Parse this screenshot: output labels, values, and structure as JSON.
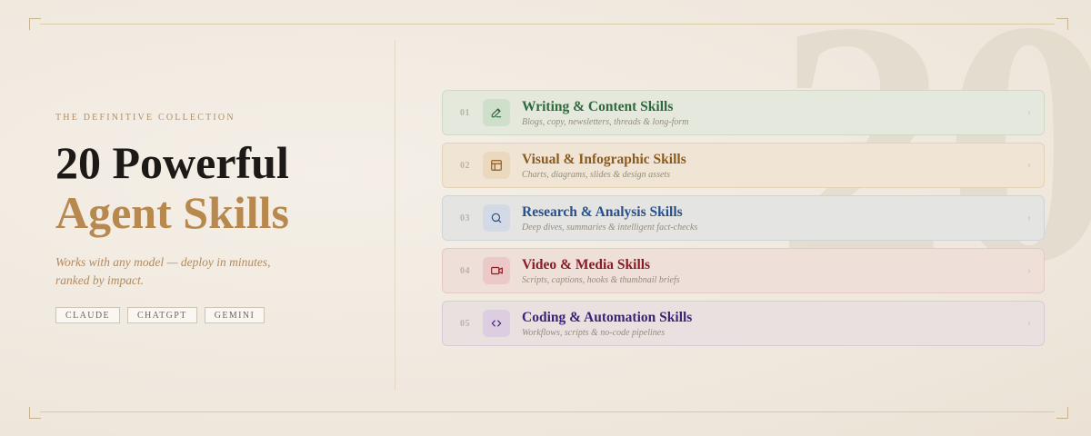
{
  "background_number": "20",
  "eyebrow": "THE DEFINITIVE COLLECTION",
  "title": {
    "line1": "20 Powerful",
    "line2": "Agent Skills"
  },
  "tagline": "Works with any model — deploy in minutes, ranked by impact.",
  "badges": [
    "CLAUDE",
    "CHATGPT",
    "GEMINI"
  ],
  "skills": [
    {
      "num": "01",
      "title": "Writing & Content Skills",
      "subtitle": "Blogs, copy, newsletters, threads & long-form",
      "icon": "pencil-icon",
      "chevron": "›",
      "colors": {
        "bg": "#e5e9dd",
        "border": "#cddbc4",
        "icon_bg": "#cfdfcb",
        "accent": "#2e6b3c"
      }
    },
    {
      "num": "02",
      "title": "Visual & Infographic Skills",
      "subtitle": "Charts, diagrams, slides & design assets",
      "icon": "layout-icon",
      "chevron": "›",
      "colors": {
        "bg": "#f0e5d4",
        "border": "#e4d2b4",
        "icon_bg": "#ead9bf",
        "accent": "#8a5a1f"
      }
    },
    {
      "num": "03",
      "title": "Research & Analysis Skills",
      "subtitle": "Deep dives, summaries & intelligent fact-checks",
      "icon": "search-icon",
      "chevron": "›",
      "colors": {
        "bg": "#e4e4e2",
        "border": "#cfd4dc",
        "icon_bg": "#d3dae6",
        "accent": "#264f8c"
      }
    },
    {
      "num": "04",
      "title": "Video & Media Skills",
      "subtitle": "Scripts, captions, hooks & thumbnail briefs",
      "icon": "video-icon",
      "chevron": "›",
      "colors": {
        "bg": "#efdfd9",
        "border": "#e6c9c4",
        "icon_bg": "#ebc9c9",
        "accent": "#8a1c24"
      }
    },
    {
      "num": "05",
      "title": "Coding & Automation Skills",
      "subtitle": "Workflows, scripts & no-code pipelines",
      "icon": "code-icon",
      "chevron": "›",
      "colors": {
        "bg": "#e9e0e0",
        "border": "#d8cbd9",
        "icon_bg": "#dccde0",
        "accent": "#3c2479"
      }
    }
  ]
}
